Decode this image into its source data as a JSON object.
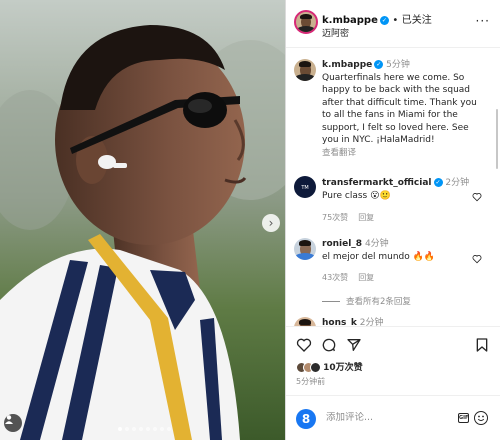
{
  "post": {
    "author": "k.mbappe",
    "follow_status": "已关注",
    "separator": "•",
    "location": "迈阿密",
    "more": "···",
    "image_dots": 8,
    "image_active_dot": 0
  },
  "caption": {
    "author": "k.mbappe",
    "time": "5分钟",
    "text": "Quarterfinals here we come. So happy to be back with the squad after that difficult time. Thank you to all the fans in Miami for the support, I felt so loved here. See you in NYC. ¡HalaMadrid!",
    "translate": "查看翻译"
  },
  "comments": [
    {
      "user": "transfermarkt_official",
      "verified": true,
      "time": "2分钟",
      "text": "Pure class 😮🙂",
      "likes": "75次赞",
      "reply": "回复"
    },
    {
      "user": "roniel_8",
      "verified": false,
      "time": "4分钟",
      "text": "el mejor del mundo 🔥🔥",
      "likes": "43次赞",
      "reply": "回复",
      "view_replies": "查看所有2条回复"
    },
    {
      "user": "hons_k",
      "time": "2分钟"
    }
  ],
  "actions": {
    "likes": "10万次赞",
    "time": "5分钟前"
  },
  "comment_box": {
    "avatar_letter": "8",
    "placeholder": "添加评论...",
    "gif": "GIF"
  },
  "colors": {
    "verified_blue": "#0095f6",
    "story_ring": "#d62976",
    "secondary_text": "#8e8e8e"
  }
}
